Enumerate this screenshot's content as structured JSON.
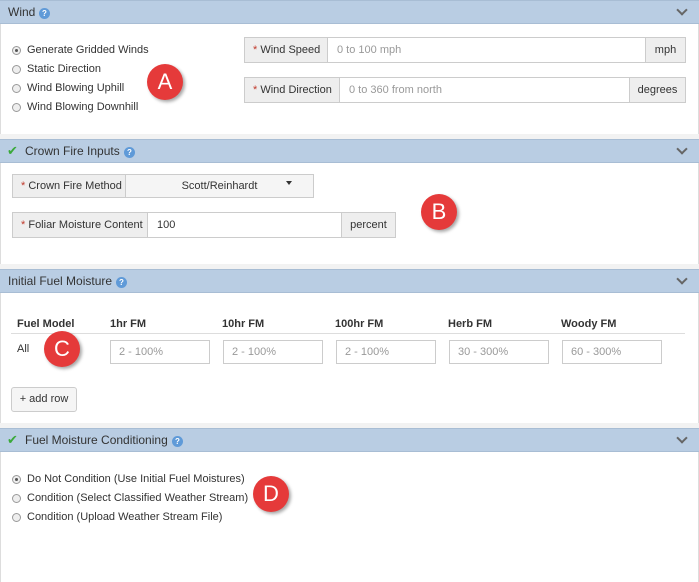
{
  "wind": {
    "title": "Wind",
    "options": [
      {
        "label": "Generate Gridded Winds",
        "checked": true
      },
      {
        "label": "Static Direction",
        "checked": false
      },
      {
        "label": "Wind Blowing Uphill",
        "checked": false
      },
      {
        "label": "Wind Blowing Downhill",
        "checked": false
      }
    ],
    "speed": {
      "label": "Wind Speed",
      "placeholder": "0 to 100 mph",
      "unit": "mph"
    },
    "direction": {
      "label": "Wind Direction",
      "placeholder": "0 to 360 from north",
      "unit": "degrees"
    },
    "badge": "A"
  },
  "crown_fire": {
    "title": "Crown Fire Inputs",
    "method": {
      "label": "Crown Fire Method",
      "value": "Scott/Reinhardt"
    },
    "foliar": {
      "label": "Foliar Moisture Content",
      "value": "100",
      "unit": "percent"
    },
    "badge": "B"
  },
  "initial_fuel_moisture": {
    "title": "Initial Fuel Moisture",
    "columns": [
      "Fuel Model",
      "1hr FM",
      "10hr FM",
      "100hr FM",
      "Herb FM",
      "Woody FM"
    ],
    "row": {
      "fuel_model": "All",
      "placeholders": [
        "2 - 100%",
        "2 - 100%",
        "2 - 100%",
        "30 - 300%",
        "60 - 300%"
      ]
    },
    "add_row_label": "+ add row",
    "badge": "C"
  },
  "conditioning": {
    "title": "Fuel Moisture Conditioning",
    "options": [
      {
        "label": "Do Not Condition (Use Initial Fuel Moistures)",
        "checked": true
      },
      {
        "label": "Condition (Select Classified Weather Stream)",
        "checked": false
      },
      {
        "label": "Condition (Upload Weather Stream File)",
        "checked": false
      }
    ],
    "badge": "D"
  },
  "icons": {
    "help": "?",
    "check": "✔",
    "required": "*"
  },
  "colors": {
    "header": "#b9cde3",
    "badge": "#e53a3a",
    "check": "#3aa93a",
    "help": "#5f9ad8"
  }
}
